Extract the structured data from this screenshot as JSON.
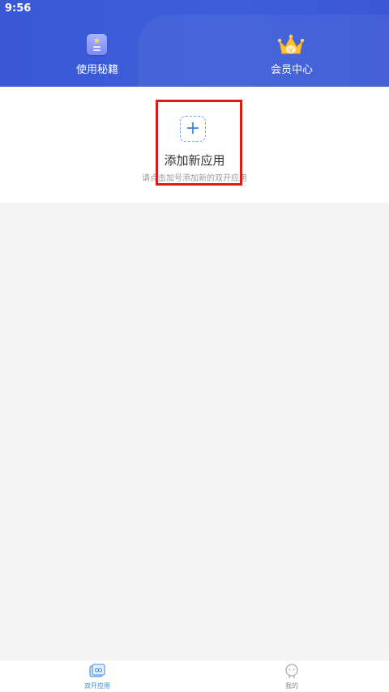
{
  "status_bar": {
    "time": "9:56"
  },
  "header": {
    "items": [
      {
        "label": "使用秘籍",
        "icon": "book-star-icon"
      },
      {
        "label": "会员中心",
        "icon": "crown-icon"
      }
    ],
    "colors": {
      "background": "#3b5bd8",
      "text": "#ffffff"
    }
  },
  "add_app": {
    "icon": "plus-icon",
    "title": "添加新应用",
    "subtitle": "请点击加号添加新的双开应用"
  },
  "bottom_nav": {
    "tabs": [
      {
        "label": "双开应用",
        "icon": "dual-app-icon",
        "active": true
      },
      {
        "label": "我的",
        "icon": "profile-icon",
        "active": false
      }
    ],
    "colors": {
      "active": "#3a8ae8",
      "inactive": "#888888"
    }
  }
}
